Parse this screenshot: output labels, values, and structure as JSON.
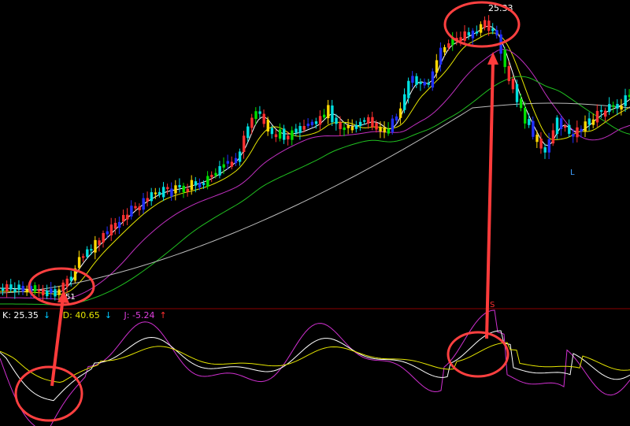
{
  "chart_data": {
    "type": "candlestick",
    "annotations": {
      "high_label": "25.33",
      "low_label": "51",
      "signal_marker": "S",
      "low_marker": "L"
    },
    "indicator": {
      "k_label": "K: 25.35",
      "k_arrow": "↓",
      "d_label": "D: 40.65",
      "d_arrow": "↓",
      "j_label": "J: -5.24",
      "j_arrow": "↑"
    },
    "colors": {
      "background": "#000000",
      "divider": "#8b0000",
      "circle": "#ff4040",
      "arrow": "#ff3b3b",
      "ma_white": "#ffffff",
      "ma_yellow": "#e6e600",
      "ma_magenta": "#c030c0",
      "ma_green": "#20c020",
      "ma_gray": "#bbbbbb",
      "k_line": "#ffffff",
      "d_line": "#e6e600",
      "j_line": "#d030d0"
    }
  }
}
